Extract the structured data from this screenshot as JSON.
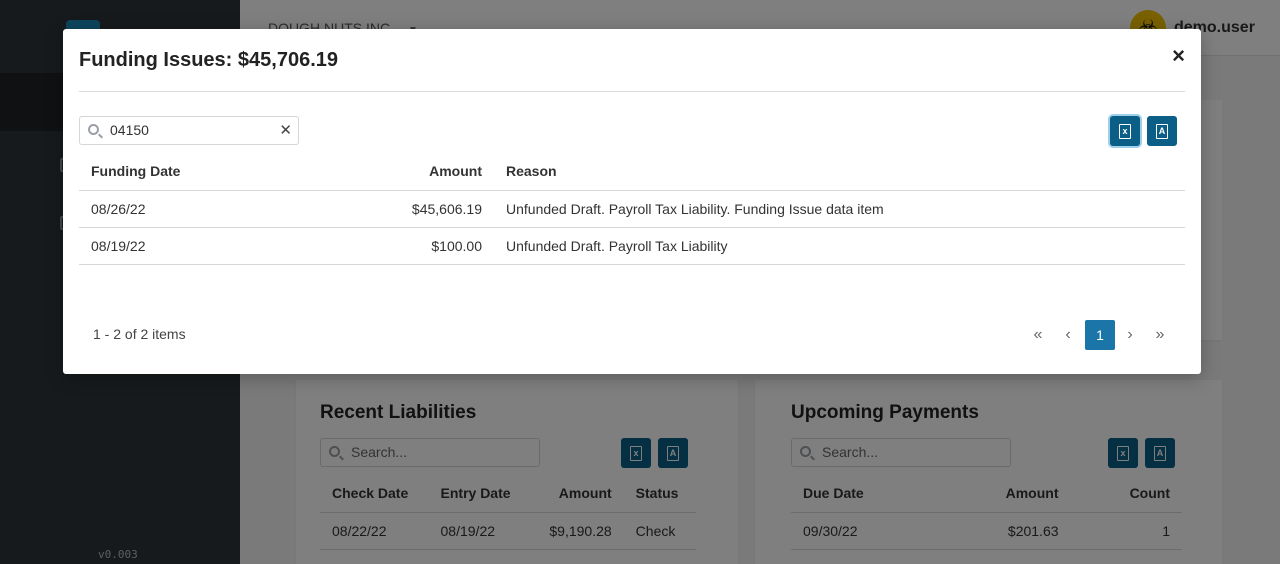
{
  "app": {
    "company": "DOUGH NUTS INC.",
    "user": "demo.user",
    "version": "v0.003"
  },
  "liabilities": {
    "title": "Recent Liabilities",
    "search_placeholder": "Search...",
    "columns": [
      "Check Date",
      "Entry Date",
      "Amount",
      "Status"
    ],
    "rows": [
      [
        "08/22/22",
        "08/19/22",
        "$9,190.28",
        "Check"
      ]
    ]
  },
  "payments": {
    "title": "Upcoming Payments",
    "search_placeholder": "Search...",
    "columns": [
      "Due Date",
      "Amount",
      "Count"
    ],
    "rows": [
      [
        "09/30/22",
        "$201.63",
        "1"
      ]
    ]
  },
  "modal": {
    "title": "Funding Issues: $45,706.19",
    "close_label": "×",
    "search_value": "04150",
    "clear_label": "✕",
    "columns": [
      "Funding Date",
      "Amount",
      "Reason"
    ],
    "rows": [
      [
        "08/26/22",
        "$45,606.19",
        "Unfunded Draft. Payroll Tax Liability. Funding Issue data item"
      ],
      [
        "08/19/22",
        "$100.00",
        "Unfunded Draft. Payroll Tax Liability"
      ]
    ],
    "items_text": "1 - 2 of 2 items",
    "current_page": "1",
    "excel_glyph": "x",
    "pdf_glyph": "A"
  }
}
